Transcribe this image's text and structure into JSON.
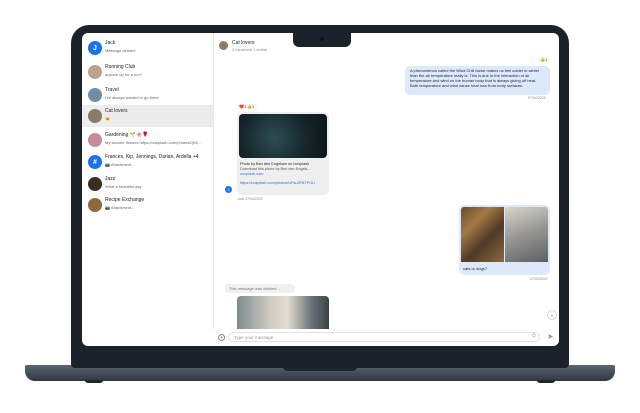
{
  "sidebar": {
    "conversations": [
      {
        "name": "Jack",
        "message": "Message deleted",
        "avatar_text": "J",
        "avatar_color": "#1a73e8"
      },
      {
        "name": "Running Club",
        "message": "anyone up for a run?",
        "avatar_text": "",
        "avatar_color": "#b8a48a"
      },
      {
        "name": "Travel",
        "message": "I've always wanted to go there",
        "avatar_text": "",
        "avatar_color": "#6f8fa8"
      },
      {
        "name": "Cat lovers",
        "message": "😺",
        "avatar_text": "",
        "avatar_color": "#8a7b6a"
      },
      {
        "name": "Gardening 🌱🌸🌹",
        "message": "My favorite flowers https://unsplash.com/photos/Qb0...",
        "avatar_text": "",
        "avatar_color": "#c98a9a"
      },
      {
        "name": "Frances, Kip, Jennings, Darian, Ardella +4",
        "message": "📷 Attachment...",
        "avatar_text": "#",
        "avatar_color": "#1a73e8"
      },
      {
        "name": "Jazz",
        "message": "What a beautiful day",
        "avatar_text": "",
        "avatar_color": "#3a2e22"
      },
      {
        "name": "Recipe Exchange",
        "message": "📷 Attachment...",
        "avatar_text": "",
        "avatar_color": "#8c6a3a"
      }
    ]
  },
  "chat": {
    "title": "Cat lovers",
    "subtitle": "2 members 1 online",
    "outgoing_text": "A phenomenon called the Wind Chill factor makes us feel colder in winter than the air temperature really is. This is due to the interaction of air temperature and wind on the human body that is always giving off heat. Both temperature and wind cause heat loss from body surfaces.",
    "outgoing_reaction": "👍1",
    "outgoing_date": "07/04/2022",
    "link_reactions": "❤️1  👍1",
    "link_title": "Photo by Ben den Engelsen on Unsplash",
    "link_desc": "Download this photo by Ben den Engels...",
    "link_host": "unsplash.com",
    "link_url": "https://unsplash.com/photos/UFw-8FBTPOLI",
    "sender_initial": "J",
    "link_meta": "Jack 07/04/2022",
    "photo_caption": "cats or dogs?",
    "photo_date": "07/04/2022",
    "deleted_text": "This message was deleted...",
    "input_placeholder": "Type your message"
  }
}
